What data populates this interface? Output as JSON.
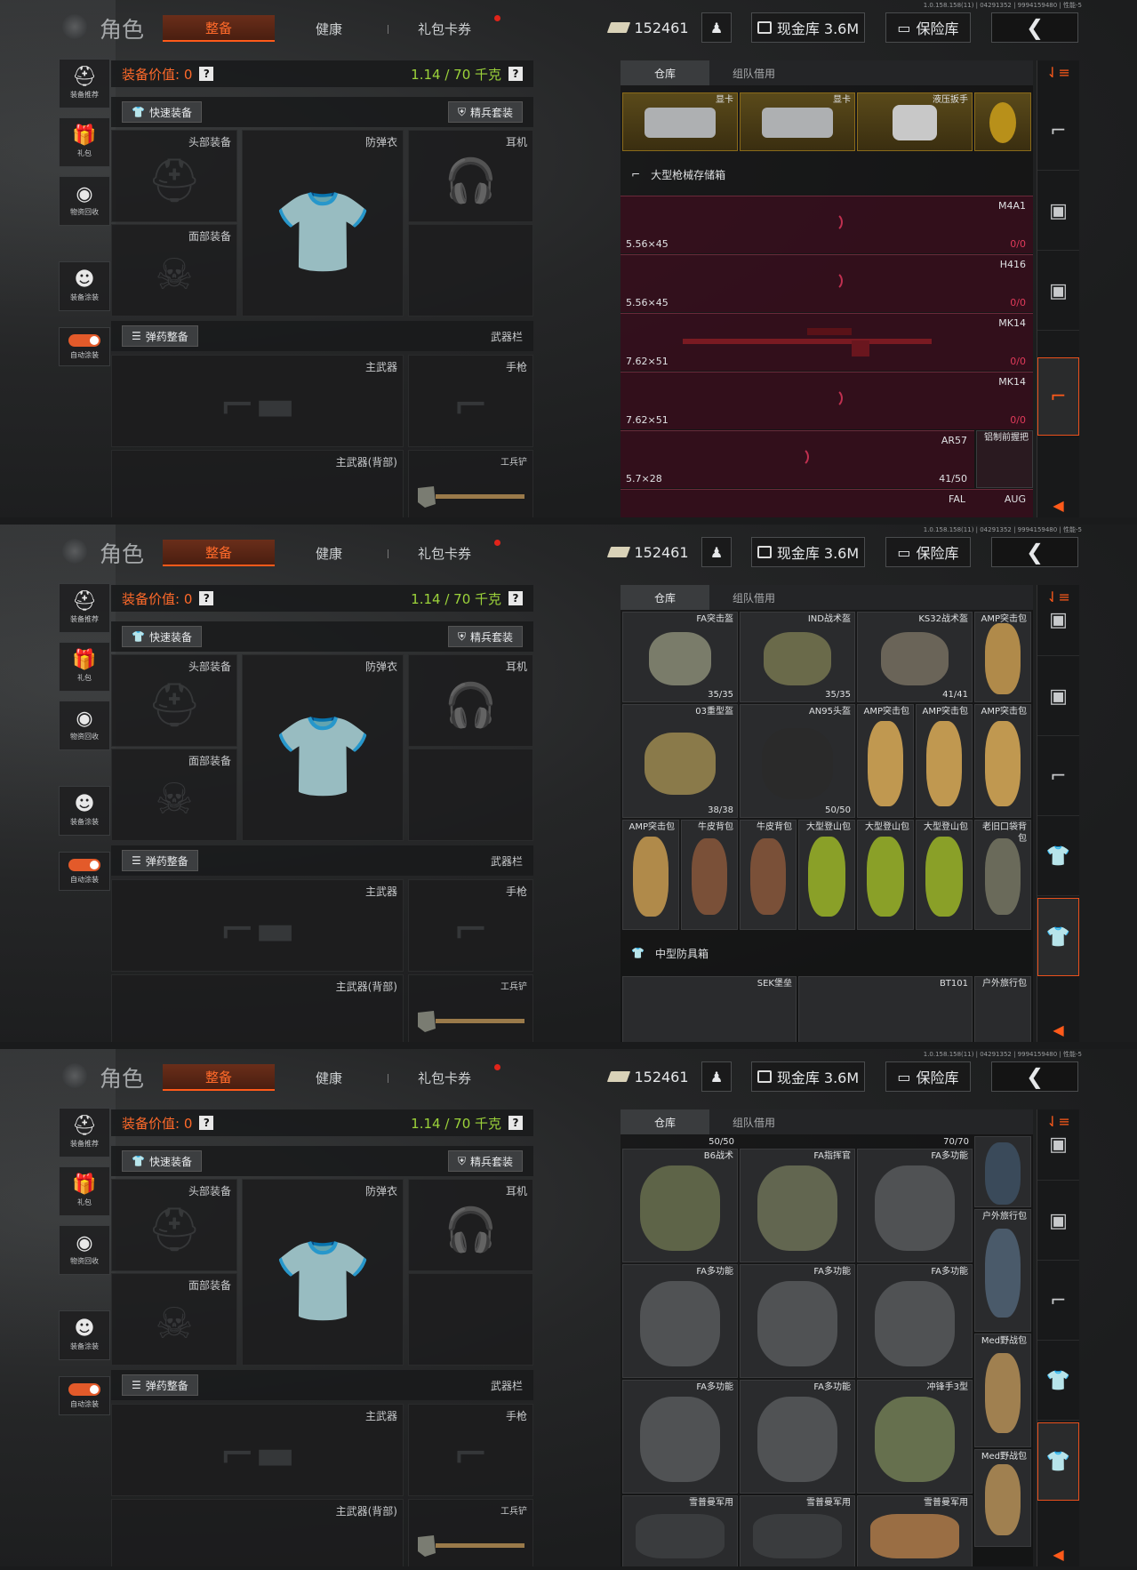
{
  "header": {
    "version": "1.0.158.158(11) | 04291352 | 9994159480 | 性能-5",
    "title": "角色",
    "tabs": [
      "整备",
      "健康",
      "礼包卡券"
    ],
    "money": "152461",
    "cash_vault": "现金库 3.6M",
    "safe_vault": "保险库"
  },
  "sidebar": {
    "items": [
      "装备推荐",
      "礼包",
      "物资回收",
      "装备涂装"
    ],
    "auto_label": "自动涂装"
  },
  "loadout": {
    "value_label": "装备价值: 0",
    "weight_label": "1.14 / 70 千克",
    "quick_equip": "快速装备",
    "elite_set": "精兵套装",
    "ammo_equip": "弹药整备",
    "weapon_bar": "武器栏",
    "slots": {
      "head": "头部装备",
      "armor": "防弹衣",
      "ear": "耳机",
      "face": "面部装备",
      "primary": "主武器",
      "pistol": "手枪",
      "primary_back": "主武器(背部)",
      "shovel": "工兵铲"
    }
  },
  "storage": {
    "tabs": [
      "仓库",
      "组队借用"
    ],
    "p1": {
      "top_items": [
        {
          "name": "显卡"
        },
        {
          "name": "显卡"
        },
        {
          "name": "液压扳手"
        },
        {
          "name": ""
        }
      ],
      "section": "大型枪械存储箱",
      "weapons": [
        {
          "name": "M4A1",
          "caliber": "5.56×45",
          "count": "0/0"
        },
        {
          "name": "H416",
          "caliber": "5.56×45",
          "count": "0/0"
        },
        {
          "name": "MK14",
          "caliber": "7.62×51",
          "count": "0/0"
        },
        {
          "name": "MK14",
          "caliber": "7.62×51",
          "count": "0/0"
        },
        {
          "name": "AR57",
          "caliber": "5.7×28",
          "count": "41/50"
        }
      ],
      "side_item": "铝制前握把",
      "bottom": [
        "FAL",
        "AUG"
      ]
    },
    "p2": {
      "row0": [
        {
          "name": "FA突击盔",
          "count": "35/35"
        },
        {
          "name": "IND战术盔",
          "count": "35/35"
        },
        {
          "name": "KS32战术盔",
          "count": "41/41"
        },
        {
          "name": "AMP突击包",
          "count": ""
        }
      ],
      "row1": [
        {
          "name": "03重型盔",
          "count": "38/38"
        },
        {
          "name": "AN95头盔",
          "count": "50/50"
        },
        {
          "name": "AMP突击包"
        },
        {
          "name": "AMP突击包"
        },
        {
          "name": "AMP突击包"
        }
      ],
      "row2": [
        "AMP突击包",
        "牛皮背包",
        "牛皮背包",
        "大型登山包",
        "大型登山包",
        "大型登山包",
        "老旧口袋背包"
      ],
      "section": "中型防具箱",
      "bottom": [
        "SEK堡垒",
        "BT101",
        "户外旅行包"
      ]
    },
    "p3": {
      "topcounts": [
        "50/50",
        "70/70"
      ],
      "grid": [
        "B6战术",
        "FA指挥官",
        "FA多功能",
        "FA多功能",
        "FA多功能",
        "FA多功能",
        "FA多功能",
        "FA多功能",
        "冲锋手3型"
      ],
      "side": [
        "户外旅行包",
        "Med野战包",
        "Med野战包"
      ],
      "bottom": [
        "雪普曼军用",
        "雪普曼军用",
        "雪普曼军用"
      ]
    }
  },
  "colors": {
    "accent": "#ff5a1a",
    "weight": "#9cd33a",
    "weapon_row": "#3c0e1e"
  }
}
